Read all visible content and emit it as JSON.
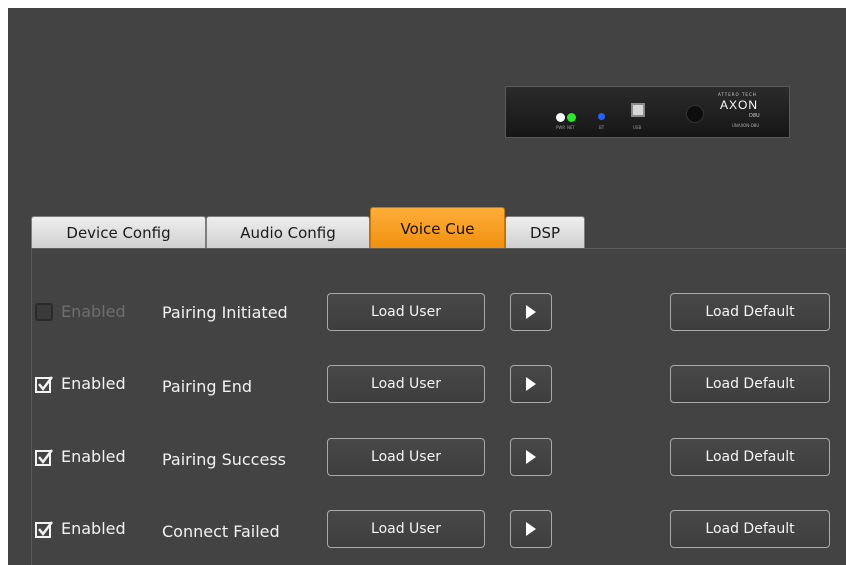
{
  "device": {
    "brand_top": "ATTERO TECH",
    "brand": "AXON",
    "model": "D8U",
    "serial": "UNAXON-D8U",
    "labels": [
      "PWR",
      "NET",
      "BT",
      "USB"
    ],
    "colors": {
      "led_white": "#ffffff",
      "led_green": "#2fe62f",
      "led_blue": "#2563ff"
    }
  },
  "tabs": [
    {
      "label": "Device Config",
      "active": false
    },
    {
      "label": "Audio Config",
      "active": false
    },
    {
      "label": "Voice Cue",
      "active": true
    },
    {
      "label": "DSP",
      "active": false
    }
  ],
  "rows": [
    {
      "enabled_label": "Enabled",
      "checked": false,
      "name": "Pairing Initiated",
      "load_user": "Load User",
      "load_default": "Load Default"
    },
    {
      "enabled_label": "Enabled",
      "checked": true,
      "name": "Pairing End",
      "load_user": "Load User",
      "load_default": "Load Default"
    },
    {
      "enabled_label": "Enabled",
      "checked": true,
      "name": "Pairing Success",
      "load_user": "Load User",
      "load_default": "Load Default"
    },
    {
      "enabled_label": "Enabled",
      "checked": true,
      "name": "Connect Failed",
      "load_user": "Load User",
      "load_default": "Load Default"
    }
  ],
  "icons": {
    "checkbox": "checkbox-checked-icon",
    "play": "play-icon"
  },
  "colors": {
    "background": "#434343",
    "accent": "#f7a01f",
    "text": "#f2f2f2",
    "disabled_text": "#6e6e6e"
  }
}
